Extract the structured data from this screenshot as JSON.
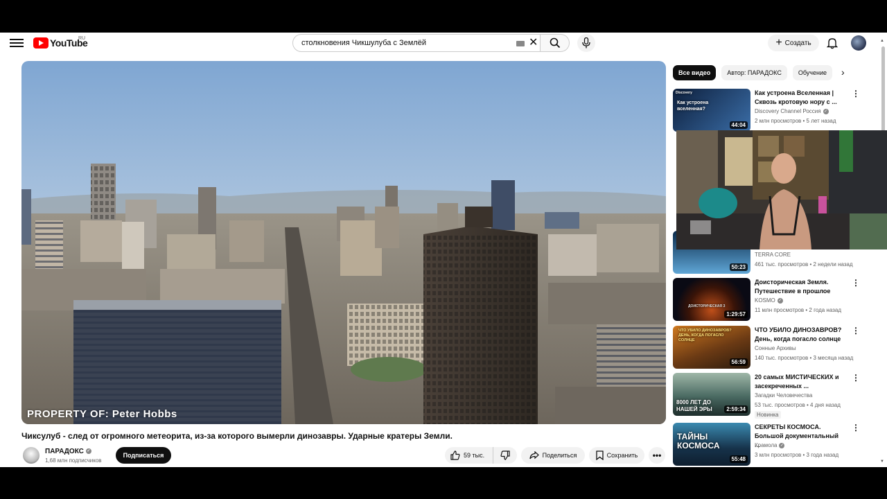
{
  "header": {
    "logo_text": "YouTube",
    "logo_region": "RU",
    "search_value": "столкновения Чикшулуба с Землёй",
    "create_label": "Создать"
  },
  "video": {
    "watermark": "PROPERTY OF: Peter Hobbs",
    "title": "Чиксулуб - след от огромного метеорита, из-за которого вымерли динозавры. Ударные кратеры Земли.",
    "channel": "ПАРАДОКС",
    "subscribers": "1,68 млн подписчиков",
    "subscribe_label": "Подписаться",
    "likes": "59 тыс.",
    "share_label": "Поделиться",
    "save_label": "Сохранить",
    "more_label": "•••"
  },
  "sidebar": {
    "chips": [
      "Все видео",
      "Автор: ПАРАДОКС",
      "Обучение"
    ],
    "recommendations": [
      {
        "title": "Как устроена Вселенная | Сквозь кротовую нору с ...",
        "channel": "Discovery Channel Россия",
        "verified": true,
        "meta": "2 млн просмотров • 5 лет назад",
        "duration": "44:04",
        "thumb_text": "Как устроена вселенная?",
        "thumb_brand": "Discovery",
        "colors": [
          "#0d1f3c",
          "#3b6ea8"
        ]
      },
      {
        "title": "",
        "channel": "TERRA CORE",
        "verified": false,
        "meta": "461 тыс. просмотров • 2 недели назад",
        "duration": "50:23",
        "thumb_text": "",
        "colors": [
          "#0b2a4a",
          "#5fa6d6"
        ]
      },
      {
        "title": "Доисторическая Земля. Путешествие в прошлое",
        "channel": "KOSMO",
        "verified": true,
        "meta": "11 млн просмотров • 2 года назад",
        "duration": "1:29:57",
        "thumb_text": "ДОИСТОРИЧЕСКАЯ З",
        "colors": [
          "#0a0a14",
          "#7a2a10"
        ]
      },
      {
        "title": "ЧТО УБИЛО ДИНОЗАВРОВ? День, когда погасло солнце",
        "channel": "Сонные Архивы",
        "verified": false,
        "meta": "140 тыс. просмотров • 3 месяца назад",
        "duration": "56:59",
        "thumb_text": "ЧТО УБИЛО ДИНОЗАВРОВ? ДЕНЬ, КОГДА ПОГАСЛО СОЛНЦЕ",
        "colors": [
          "#3a2410",
          "#d07a20"
        ]
      },
      {
        "title": "20 самых МИСТИЧЕСКИХ и засекреченных ...",
        "channel": "Загадки Человечества",
        "verified": false,
        "meta": "53 тыс. просмотров • 4 дня назад",
        "badge": "Новинка",
        "duration": "2:59:34",
        "thumb_text": "8000 ЛЕТ ДО НАШЕЙ ЭРЫ",
        "colors": [
          "#2f4a46",
          "#9fb7a8"
        ]
      },
      {
        "title": "СЕКРЕТЫ КОСМОСА. Большой документальный ...",
        "channel": "Крамола",
        "verified": true,
        "meta": "3 млн просмотров • 3 года назад",
        "duration": "55:48",
        "thumb_text": "ТАЙНЫ КОСМОСА",
        "colors": [
          "#0e1e2e",
          "#3b8ab0"
        ]
      }
    ]
  },
  "colors": {
    "accent_red": "#ff0000",
    "text": "#0f0f0f",
    "secondary": "#606060"
  }
}
